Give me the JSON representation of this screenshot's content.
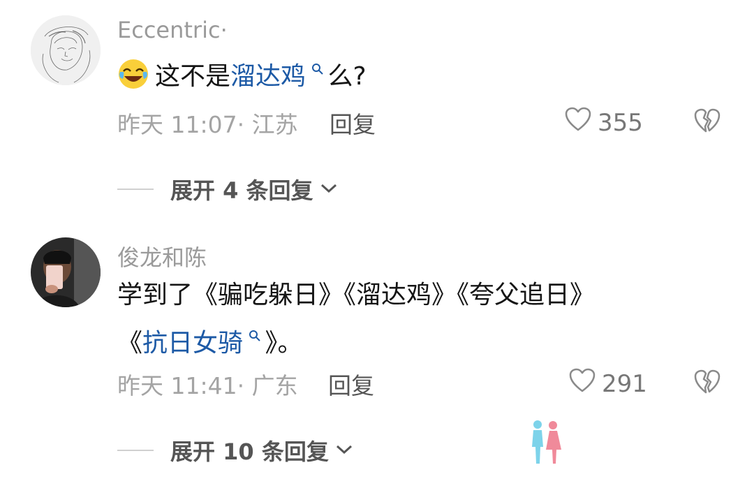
{
  "comments": [
    {
      "username": "Eccentric·",
      "text_before": "这不是",
      "link_text": "溜达鸡",
      "text_after": "么?",
      "emoji": "crying-laughing-emoji",
      "timestamp": "昨天 11:07· 江苏",
      "reply_label": "回复",
      "likes": "355",
      "expand_label": "展开 4 条回复"
    },
    {
      "username": "俊龙和陈",
      "line1": "学到了《骗吃躲日》《溜达鸡》《夸父追日》",
      "line2_before": "《",
      "link_text": "抗日女骑",
      "line2_after": "》。",
      "timestamp": "昨天 11:41· 广东",
      "reply_label": "回复",
      "likes": "291",
      "expand_label": "展开 10 条回复"
    }
  ],
  "icons": {
    "like": "heart-outline-icon",
    "dislike": "broken-heart-icon",
    "expand": "chevron-down-icon",
    "link": "search-icon"
  },
  "colors": {
    "link": "#1d5aa6",
    "meta": "#a4a4a4"
  }
}
